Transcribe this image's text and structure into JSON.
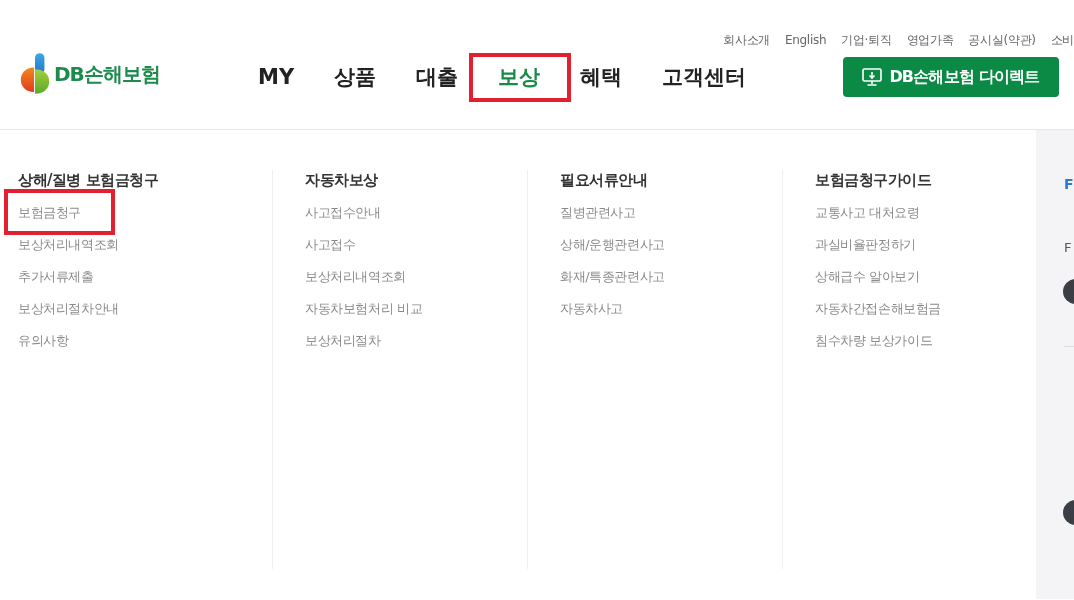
{
  "utility_links": [
    "회사소개",
    "English",
    "기업·퇴직",
    "영업가족",
    "공시실(약관)",
    "소비"
  ],
  "logo": {
    "text": "DB손해보험"
  },
  "nav": [
    {
      "label": "MY",
      "selected": false,
      "highlighted": false
    },
    {
      "label": "상품",
      "selected": false,
      "highlighted": false
    },
    {
      "label": "대출",
      "selected": false,
      "highlighted": false
    },
    {
      "label": "보상",
      "selected": true,
      "highlighted": true
    },
    {
      "label": "혜택",
      "selected": false,
      "highlighted": false
    },
    {
      "label": "고객센터",
      "selected": false,
      "highlighted": false
    }
  ],
  "direct_button": {
    "label": "DB손해보험 다이렉트"
  },
  "mega_menu": {
    "columns": [
      {
        "heading": "상해/질병 보험금청구",
        "items": [
          {
            "label": "보험금청구",
            "highlighted": true
          },
          {
            "label": "보상처리내역조회",
            "highlighted": false
          },
          {
            "label": "추가서류제출",
            "highlighted": false
          },
          {
            "label": "보상처리절차안내",
            "highlighted": false
          },
          {
            "label": "유의사항",
            "highlighted": false
          }
        ]
      },
      {
        "heading": "자동차보상",
        "items": [
          {
            "label": "사고접수안내",
            "highlighted": false
          },
          {
            "label": "사고접수",
            "highlighted": false
          },
          {
            "label": "보상처리내역조회",
            "highlighted": false
          },
          {
            "label": "자동차보험처리 비교",
            "highlighted": false
          },
          {
            "label": "보상처리절차",
            "highlighted": false
          }
        ]
      },
      {
        "heading": "필요서류안내",
        "items": [
          {
            "label": "질병관련사고",
            "highlighted": false
          },
          {
            "label": "상해/운행관련사고",
            "highlighted": false
          },
          {
            "label": "화재/특종관련사고",
            "highlighted": false
          },
          {
            "label": "자동차사고",
            "highlighted": false
          }
        ]
      },
      {
        "heading": "보험금청구가이드",
        "items": [
          {
            "label": "교통사고 대처요령",
            "highlighted": false
          },
          {
            "label": "과실비율판정하기",
            "highlighted": false
          },
          {
            "label": "상해급수 알아보기",
            "highlighted": false
          },
          {
            "label": "자동차간접손해보험금",
            "highlighted": false
          },
          {
            "label": "침수차량 보상가이드",
            "highlighted": false
          }
        ]
      }
    ]
  },
  "side_panel": {
    "title": "F",
    "text": "F"
  }
}
